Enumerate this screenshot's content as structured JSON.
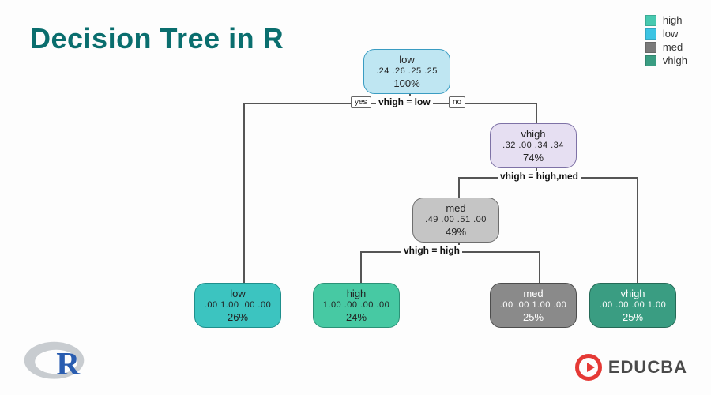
{
  "title": "Decision Tree in R",
  "legend": [
    {
      "label": "high",
      "color": "#47c9b0"
    },
    {
      "label": "low",
      "color": "#3cc4e3"
    },
    {
      "label": "med",
      "color": "#7a7a7a"
    },
    {
      "label": "vhigh",
      "color": "#3a9d82"
    }
  ],
  "splits": {
    "s1": {
      "text": "vhigh = low",
      "yes": "yes",
      "no": "no"
    },
    "s2": {
      "text": "vhigh = high,med"
    },
    "s3": {
      "text": "vhigh = high"
    }
  },
  "nodes": {
    "root": {
      "label": "low",
      "probs": ".24  .26  .25  .25",
      "pct": "100%",
      "fill": "#bfe6f2",
      "stroke": "#3a9cc2"
    },
    "n_vhigh": {
      "label": "vhigh",
      "probs": ".32  .00  .34  .34",
      "pct": "74%",
      "fill": "#e6dff2",
      "stroke": "#7e72a6"
    },
    "n_med": {
      "label": "med",
      "probs": ".49  .00  .51  .00",
      "pct": "49%",
      "fill": "#c5c5c5",
      "stroke": "#6e6e6e"
    },
    "leaf_low": {
      "label": "low",
      "probs": ".00  1.00  .00  .00",
      "pct": "26%",
      "fill": "#3cc4c0",
      "stroke": "#1f8f8c"
    },
    "leaf_high": {
      "label": "high",
      "probs": "1.00  .00  .00  .00",
      "pct": "24%",
      "fill": "#47c9a3",
      "stroke": "#2b9277"
    },
    "leaf_med": {
      "label": "med",
      "probs": ".00  .00  1.00  .00",
      "pct": "25%",
      "fill": "#8a8a8a",
      "stroke": "#4d4d4d"
    },
    "leaf_vhigh": {
      "label": "vhigh",
      "probs": ".00  .00  .00  1.00",
      "pct": "25%",
      "fill": "#3a9d82",
      "stroke": "#256a57"
    }
  },
  "brand": {
    "name": "EDUCBA",
    "rlogo": "R"
  },
  "chart_data": {
    "type": "table",
    "description": "rpart decision tree classifying target into {high, low, med, vhigh} by splits on variable 'vhigh'",
    "classes": [
      "high",
      "low",
      "med",
      "vhigh"
    ],
    "legend_colors": {
      "high": "#47c9b0",
      "low": "#3cc4e3",
      "med": "#7a7a7a",
      "vhigh": "#3a9d82"
    },
    "tree": {
      "id": "root",
      "predicted": "low",
      "class_probs": {
        "high": 0.24,
        "low": 0.26,
        "med": 0.25,
        "vhigh": 0.25
      },
      "coverage_pct": 100,
      "split": {
        "var": "vhigh",
        "rule": "vhigh = low",
        "yes_goes_left": true
      },
      "left": {
        "id": "leaf_low",
        "predicted": "low",
        "class_probs": {
          "high": 0.0,
          "low": 1.0,
          "med": 0.0,
          "vhigh": 0.0
        },
        "coverage_pct": 26
      },
      "right": {
        "id": "n_vhigh",
        "predicted": "vhigh",
        "class_probs": {
          "high": 0.32,
          "low": 0.0,
          "med": 0.34,
          "vhigh": 0.34
        },
        "coverage_pct": 74,
        "split": {
          "var": "vhigh",
          "rule": "vhigh = high,med",
          "yes_goes_left": true
        },
        "left": {
          "id": "n_med",
          "predicted": "med",
          "class_probs": {
            "high": 0.49,
            "low": 0.0,
            "med": 0.51,
            "vhigh": 0.0
          },
          "coverage_pct": 49,
          "split": {
            "var": "vhigh",
            "rule": "vhigh = high",
            "yes_goes_left": true
          },
          "left": {
            "id": "leaf_high",
            "predicted": "high",
            "class_probs": {
              "high": 1.0,
              "low": 0.0,
              "med": 0.0,
              "vhigh": 0.0
            },
            "coverage_pct": 24
          },
          "right": {
            "id": "leaf_med",
            "predicted": "med",
            "class_probs": {
              "high": 0.0,
              "low": 0.0,
              "med": 1.0,
              "vhigh": 0.0
            },
            "coverage_pct": 25
          }
        },
        "right": {
          "id": "leaf_vhigh",
          "predicted": "vhigh",
          "class_probs": {
            "high": 0.0,
            "low": 0.0,
            "med": 0.0,
            "vhigh": 1.0
          },
          "coverage_pct": 25
        }
      }
    }
  }
}
